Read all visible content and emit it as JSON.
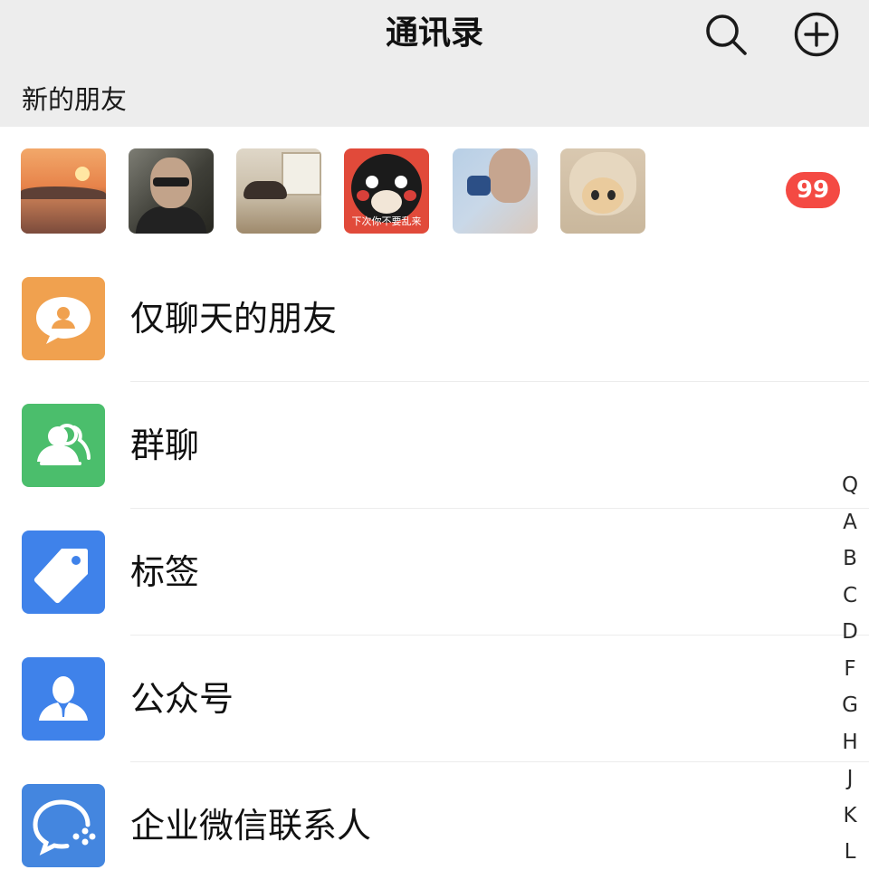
{
  "header": {
    "title": "通讯录",
    "search_icon": "search-icon",
    "add_icon": "add-circle-icon"
  },
  "new_friends": {
    "label": "新的朋友",
    "avatars": [
      "sunset-avatar",
      "man-sunglasses-avatar",
      "cat-window-avatar",
      "kumamon-avatar",
      "girl-cup-avatar",
      "cat-hat-avatar"
    ],
    "kumamon_caption": "下次你不要乱来",
    "badge": "99",
    "badge_color": "#f44a43"
  },
  "entries": [
    {
      "label": "仅聊天的朋友",
      "icon": "chat-person-icon",
      "color": "#f0a14f"
    },
    {
      "label": "群聊",
      "icon": "group-icon",
      "color": "#4bbe6c"
    },
    {
      "label": "标签",
      "icon": "tag-icon",
      "color": "#3f82ea"
    },
    {
      "label": "公众号",
      "icon": "official-account-icon",
      "color": "#3f82ea"
    },
    {
      "label": "企业微信联系人",
      "icon": "work-contact-icon",
      "color": "#4486df"
    }
  ],
  "index_letters": [
    "Q",
    "A",
    "B",
    "C",
    "D",
    "F",
    "G",
    "H",
    "J",
    "K",
    "L"
  ]
}
